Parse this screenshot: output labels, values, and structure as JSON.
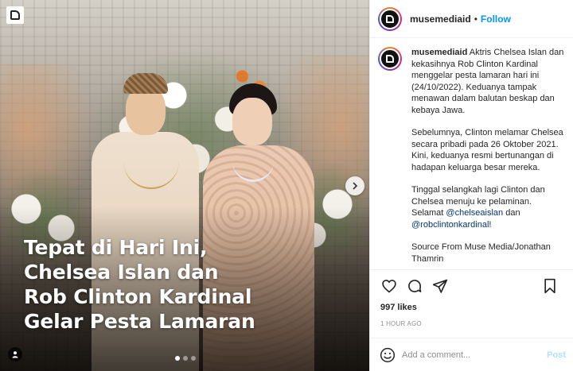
{
  "media": {
    "headline_lines": [
      "Tepat di Hari Ini,",
      "Chelsea Islan dan",
      "Rob Clinton Kardinal",
      "Gelar Pesta Lamaran"
    ],
    "carousel_total": 3,
    "carousel_active": 1,
    "icons": {
      "corner_logo": "muse-logo-icon",
      "next": "chevron-right-icon",
      "user_tag": "user-tag-icon"
    }
  },
  "header": {
    "username": "musemediaid",
    "separator": "•",
    "follow_label": "Follow",
    "follow_color": "#0095f6"
  },
  "caption": {
    "username": "musemediaid",
    "p1": "Aktris Chelsea Islan dan kekasihnya Rob Clinton Kardinal menggelar pesta lamaran hari ini (24/10/2022). Keduanya tampak menawan dalam balutan beskap dan kebaya Jawa.",
    "p2": "Sebelumnya, Clinton melamar Chelsea secara pribadi pada 26 Oktober 2021. Kini, keduanya resmi bertunangan di hadapan keluarga besar mereka.",
    "p3_text": "Tinggal selangkah lagi Clinton dan Chelsea menuju ke pelaminan.",
    "p3_selamat": "Selamat",
    "mention_1": "@chelseaislan",
    "p3_dan": "dan",
    "mention_2": "@robclintonkardinal",
    "p3_end": "!",
    "p4": "Source From Muse Media/Jonathan Thamrin"
  },
  "actions": {
    "icons": [
      "heart-icon",
      "comment-icon",
      "share-icon",
      "bookmark-icon"
    ]
  },
  "likes": "997 likes",
  "timestamp": "1 HOUR AGO",
  "comment": {
    "placeholder": "Add a comment...",
    "post_label": "Post",
    "emoji_icon": "emoji-icon"
  }
}
